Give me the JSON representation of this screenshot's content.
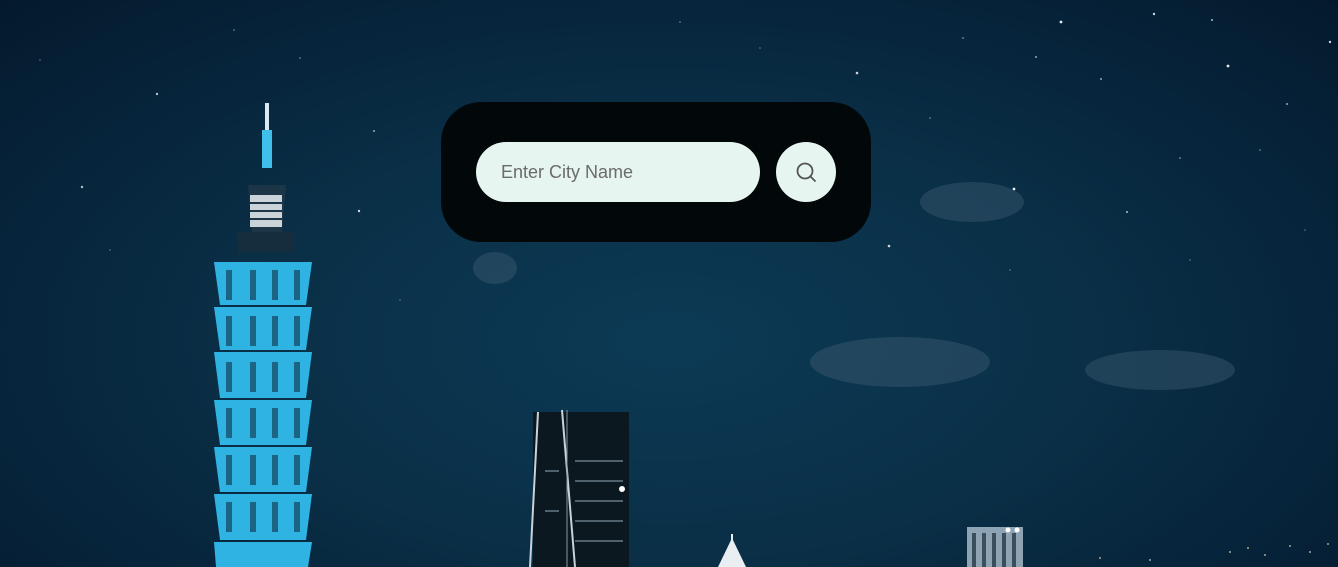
{
  "search": {
    "placeholder": "Enter City Name",
    "value": ""
  },
  "icons": {
    "search_button": "search-icon"
  },
  "colors": {
    "card_background": "#020709",
    "input_background": "#e6f5f0",
    "placeholder_text": "#6b6b6b",
    "sky": "#0a2f46"
  }
}
